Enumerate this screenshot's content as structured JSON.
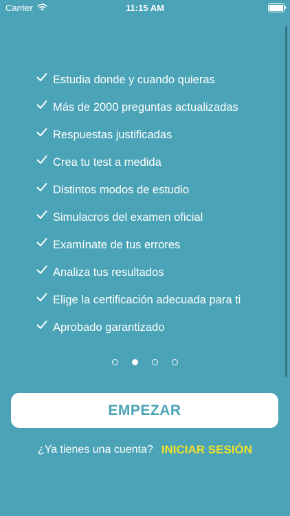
{
  "status_bar": {
    "carrier": "Carrier",
    "time": "11:15 AM",
    "icons": [
      "wifi-icon",
      "battery-icon"
    ]
  },
  "features": [
    "Estudia donde y cuando quieras",
    "Más de 2000 preguntas actualizadas",
    "Respuestas justificadas",
    "Crea tu test a medida",
    "Distintos modos de estudio",
    "Simulacros del examen oficial",
    "Examínate de tus errores",
    "Analiza tus resultados",
    "Elige la certificación adecuada para ti",
    "Aprobado garantizado"
  ],
  "pager": {
    "total": 4,
    "active_index": 1
  },
  "start_button_label": "EMPEZAR",
  "login": {
    "prompt": "¿Ya tienes una cuenta?",
    "link_label": "INICIAR SESIÓN"
  },
  "colors": {
    "background": "#4aa3b6",
    "button_text": "#4aa3b6",
    "link": "#f2e12a",
    "text": "#ffffff"
  }
}
